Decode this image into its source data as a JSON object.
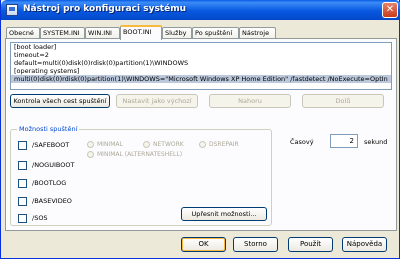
{
  "window": {
    "title": "Nástroj pro konfiguraci systému",
    "close_glyph": "✕",
    "icon": "msconfig-app-icon"
  },
  "tabs": [
    {
      "label": "Obecné"
    },
    {
      "label": "SYSTEM.INI"
    },
    {
      "label": "WIN.INI"
    },
    {
      "label": "BOOT.INI"
    },
    {
      "label": "Služby"
    },
    {
      "label": "Po spuštění"
    },
    {
      "label": "Nástroje"
    }
  ],
  "active_tab": "BOOT.INI",
  "boot_ini": {
    "lines": [
      "[boot loader]",
      "timeout=2",
      "default=multi(0)disk(0)rdisk(0)partition(1)\\WINDOWS",
      "[operating systems]",
      "multi(0)disk(0)rdisk(0)partition(1)\\WINDOWS=\"Microsoft Windows XP Home Edition\" /fastdetect /NoExecute=OptIn"
    ],
    "selected_line": 4
  },
  "actions": {
    "check_paths": "Kontrola všech cest spuštění",
    "set_default": "Nastavit jako výchozí",
    "move_up": "Nahoru",
    "move_down": "Dolů"
  },
  "boot_options": {
    "legend": "Možnosti spuštění",
    "checkboxes": [
      {
        "label": "/SAFEBOOT",
        "checked": false
      },
      {
        "label": "/NOGUIBOOT",
        "checked": false
      },
      {
        "label": "/BOOTLOG",
        "checked": false
      },
      {
        "label": "/BASEVIDEO",
        "checked": false
      },
      {
        "label": "/SOS",
        "checked": false
      }
    ],
    "safeboot_modes": [
      {
        "label": "MINIMAL"
      },
      {
        "label": "NETWORK"
      },
      {
        "label": "DSREPAIR"
      },
      {
        "label": "MINIMAL (ALTERNATESHELL)"
      }
    ],
    "advanced_button": "Upřesnit možnosti..."
  },
  "timeout": {
    "label": "Časový",
    "value": "2",
    "unit": "sekund"
  },
  "footer": {
    "ok": "OK",
    "cancel": "Storno",
    "apply": "Použít",
    "help": "Nápověda"
  }
}
